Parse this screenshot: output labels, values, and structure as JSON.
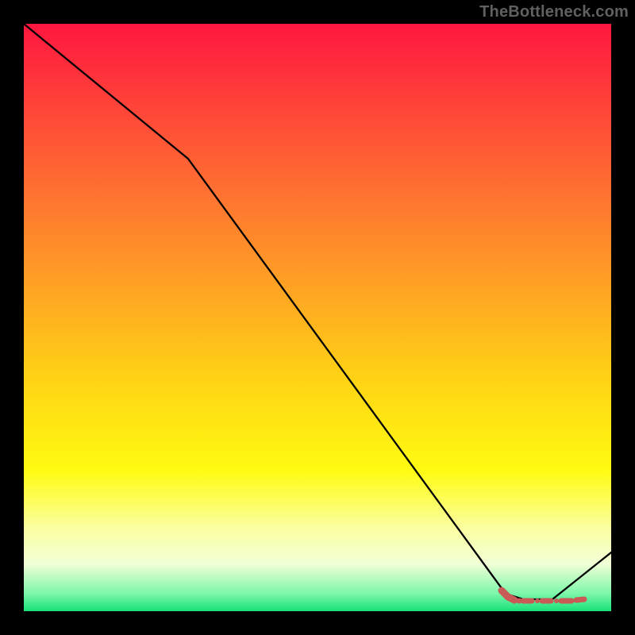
{
  "watermark": "TheBottleneck.com",
  "chart_data": {
    "type": "line",
    "title": "",
    "xlabel": "",
    "ylabel": "",
    "xlim": [
      0,
      100
    ],
    "ylim": [
      0,
      100
    ],
    "x": [
      0,
      28,
      82,
      85,
      90,
      100
    ],
    "values": [
      100,
      77,
      3,
      2,
      2,
      10
    ],
    "background": {
      "kind": "vertical-gradient",
      "stops": [
        {
          "color": "#ff163f",
          "pos": 0.0
        },
        {
          "color": "#ff3d3a",
          "pos": 0.12
        },
        {
          "color": "#ff6f32",
          "pos": 0.28
        },
        {
          "color": "#ffa323",
          "pos": 0.45
        },
        {
          "color": "#ffd714",
          "pos": 0.62
        },
        {
          "color": "#fffb11",
          "pos": 0.76
        },
        {
          "color": "#fbffa3",
          "pos": 0.86
        },
        {
          "color": "#f0ffd6",
          "pos": 0.92
        },
        {
          "color": "#7cf7aa",
          "pos": 0.97
        },
        {
          "color": "#17e07a",
          "pos": 1.0
        }
      ]
    },
    "overlay_region": {
      "note": "flat segment rendered as thick reddish dashed/noisy band",
      "color": "#c95b56",
      "x_start": 82,
      "x_end": 95,
      "y": 2
    }
  }
}
